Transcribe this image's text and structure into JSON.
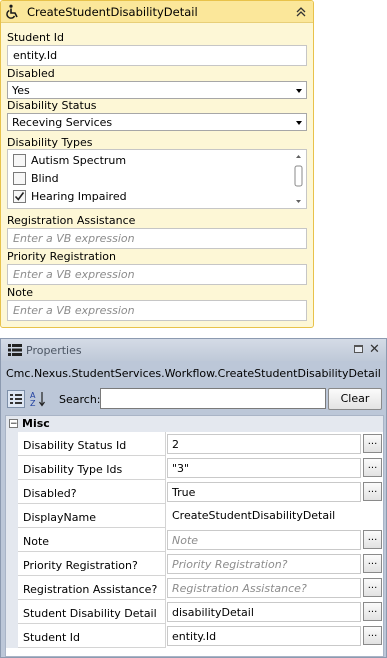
{
  "activity": {
    "title": "CreateStudentDisabilityDetail",
    "icon": "wheelchair-accessibility-icon",
    "fields": {
      "student_id": {
        "label": "Student Id",
        "value": "entity.Id"
      },
      "disabled": {
        "label": "Disabled",
        "value": "Yes"
      },
      "disability_status": {
        "label": "Disability Status",
        "value": "Receving Services"
      },
      "disability_types": {
        "label": "Disability Types",
        "items": [
          {
            "label": "Autism Spectrum",
            "checked": false
          },
          {
            "label": "Blind",
            "checked": false
          },
          {
            "label": "Hearing Impaired",
            "checked": true
          }
        ]
      },
      "registration_assistance": {
        "label": "Registration Assistance",
        "placeholder": "Enter a VB expression"
      },
      "priority_registration": {
        "label": "Priority Registration",
        "placeholder": "Enter a VB expression"
      },
      "note": {
        "label": "Note",
        "placeholder": "Enter a VB expression"
      }
    }
  },
  "properties": {
    "title": "Properties",
    "type_name": "Cmc.Nexus.StudentServices.Workflow.CreateStudentDisabilityDetail",
    "search_label": "Search:",
    "search_value": "",
    "clear_label": "Clear",
    "category": "Misc",
    "ellipsis": "...",
    "rows": [
      {
        "name": "Disability Status Id",
        "value": "2"
      },
      {
        "name": "Disability Type Ids",
        "value": "\"3\""
      },
      {
        "name": "Disabled?",
        "value": "True"
      },
      {
        "name": "DisplayName",
        "value": "CreateStudentDisabilityDetail"
      },
      {
        "name": "Note",
        "value": "Note"
      },
      {
        "name": "Priority Registration?",
        "value": "Priority Registration?"
      },
      {
        "name": "Registration Assistance?",
        "value": "Registration Assistance?"
      },
      {
        "name": "Student Disability Detail",
        "value": "disabilityDetail"
      },
      {
        "name": "Student Id",
        "value": "entity.Id"
      }
    ]
  },
  "colors": {
    "activity_background": "#fdf7d6",
    "activity_header": "#fbe79a",
    "activity_border": "#e8c24a",
    "properties_background": "#bcc7d8",
    "placeholder_text": "#8c8c8c"
  }
}
